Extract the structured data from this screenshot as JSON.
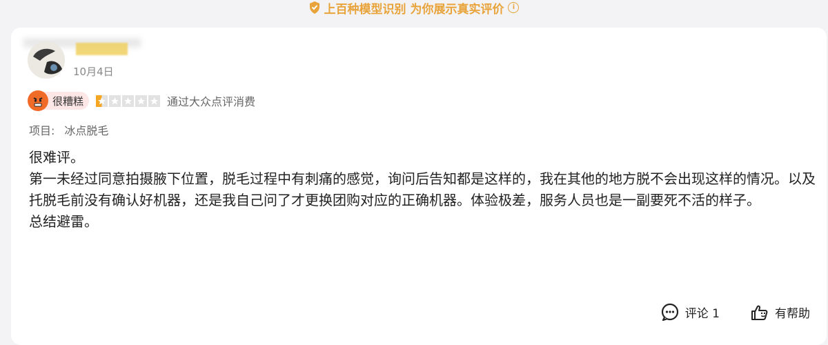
{
  "banner": {
    "text": "上百种模型识别 为你展示真实评价",
    "info_icon": "i"
  },
  "review": {
    "date": "10月4日",
    "mood": {
      "label": "很糟糕",
      "color": "#f06a28"
    },
    "stars": {
      "filled": 0.5,
      "total": 5,
      "fill_color": "#f5a623"
    },
    "source": "通过大众点评消费",
    "project_label": "项目:",
    "project_value": "冰点脱毛",
    "paragraphs": [
      "很难评。",
      "第一未经过同意拍摄腋下位置，脱毛过程中有刺痛的感觉，询问后告知都是这样的，我在其他的地方脱不会出现这样的情况。以及托脱毛前没有确认好机器，还是我自己问了才更换团购对应的正确机器。体验极差，服务人员也是一副要死不活的样子。",
      "总结避雷。"
    ]
  },
  "actions": {
    "comment_label": "评论 1",
    "helpful_label": "有帮助"
  }
}
